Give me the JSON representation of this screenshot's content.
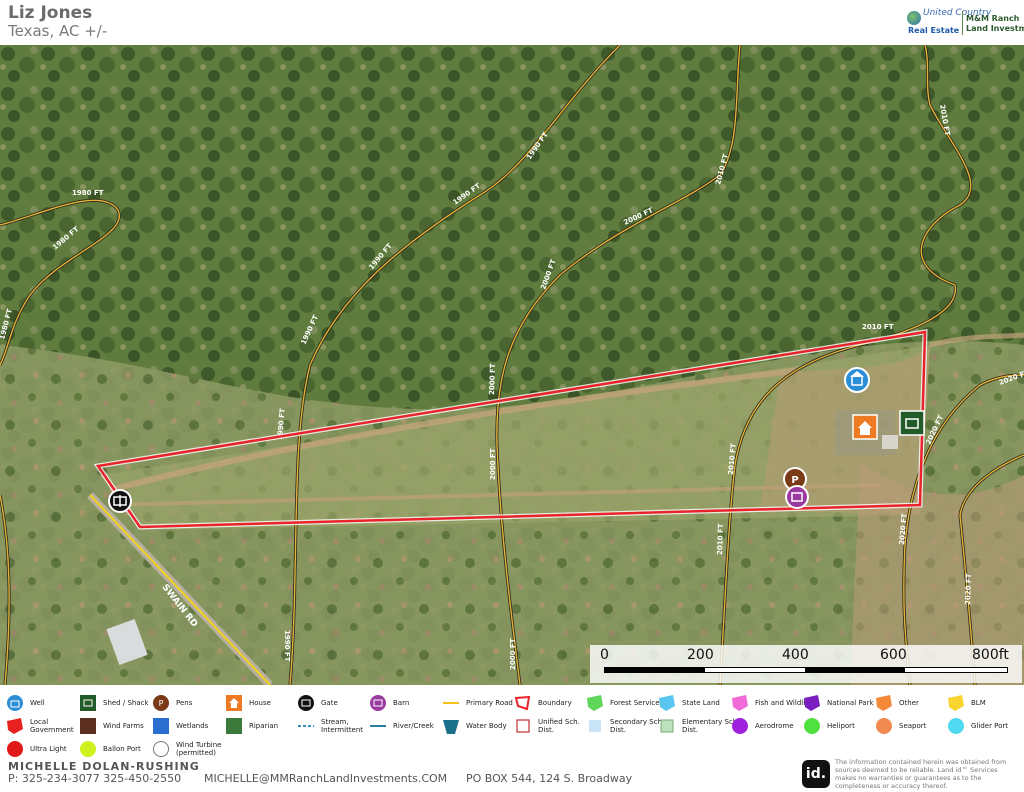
{
  "header": {
    "owner": "Liz Jones",
    "location": "Texas,  AC +/-",
    "logo_line1": "United Country",
    "logo_line2": "Real Estate",
    "logo_brand1": "M&M Ranch",
    "logo_brand2": "Land Investments"
  },
  "map": {
    "contours": [
      "1980 FT",
      "1980 FT",
      "1980 FT",
      "1990 FT",
      "1990 FT",
      "1990 FT",
      "1990 FT",
      "1990 FT",
      "1990 FT",
      "2000 FT",
      "2000 FT",
      "2000 FT",
      "2000 FT",
      "2000 FT",
      "2010 FT",
      "2010 FT",
      "2010 FT",
      "2010 FT",
      "2010 FT",
      "2020 FT",
      "2020 FT",
      "2020 FT",
      "2020 FT"
    ],
    "road_label": "SWAIN RD",
    "colors": {
      "boundary": "#e8232a",
      "contour": "#e0b43a",
      "road": "#f2d21a"
    },
    "markers": [
      {
        "name": "well",
        "icon": "well-icon"
      },
      {
        "name": "house",
        "icon": "house-icon"
      },
      {
        "name": "shed",
        "icon": "shed-icon"
      },
      {
        "name": "pens",
        "icon": "pens-icon"
      },
      {
        "name": "barn",
        "icon": "barn-icon"
      },
      {
        "name": "gate",
        "icon": "gate-icon"
      }
    ]
  },
  "scalebar": {
    "labels": [
      "0",
      "200",
      "400",
      "600",
      "800ft"
    ]
  },
  "legend": [
    {
      "label": "Well",
      "icon": "well-icon"
    },
    {
      "label": "Shed / Shack",
      "icon": "shed-icon"
    },
    {
      "label": "Pens",
      "icon": "pens-icon"
    },
    {
      "label": "House",
      "icon": "house-icon"
    },
    {
      "label": "Gate",
      "icon": "gate-icon"
    },
    {
      "label": "Barn",
      "icon": "barn-icon"
    },
    {
      "label": "Primary Road",
      "icon": "primary-road-icon"
    },
    {
      "label": "Boundary",
      "icon": "boundary-icon"
    },
    {
      "label": "Forest Service",
      "icon": "forest-service-icon"
    },
    {
      "label": "State Land",
      "icon": "state-land-icon"
    },
    {
      "label": "Fish and Wildlife",
      "icon": "fish-wildlife-icon"
    },
    {
      "label": "National Park",
      "icon": "national-park-icon"
    },
    {
      "label": "Other",
      "icon": "other-icon"
    },
    {
      "label": "BLM",
      "icon": "blm-icon"
    },
    {
      "label": "Local Government",
      "icon": "local-government-icon"
    },
    {
      "label": "Wind Farms",
      "icon": "wind-farms-icon"
    },
    {
      "label": "Wetlands",
      "icon": "wetlands-icon"
    },
    {
      "label": "Riparian",
      "icon": "riparian-icon"
    },
    {
      "label": "Stream, Intermittent",
      "icon": "stream-intermittent-icon"
    },
    {
      "label": "River/Creek",
      "icon": "river-creek-icon"
    },
    {
      "label": "Water Body",
      "icon": "water-body-icon"
    },
    {
      "label": "Unified Sch. Dist.",
      "icon": "unified-school-icon"
    },
    {
      "label": "Secondary Sch. Dist.",
      "icon": "secondary-school-icon"
    },
    {
      "label": "Elementary Sch. Dist.",
      "icon": "elementary-school-icon"
    },
    {
      "label": "Aerodrome",
      "icon": "aerodrome-icon"
    },
    {
      "label": "Heliport",
      "icon": "heliport-icon"
    },
    {
      "label": "Seaport",
      "icon": "seaport-icon"
    },
    {
      "label": "Glider Port",
      "icon": "glider-port-icon"
    },
    {
      "label": "Ultra Light",
      "icon": "ultra-light-icon"
    },
    {
      "label": "Ballon Port",
      "icon": "ballon-port-icon"
    },
    {
      "label": "Wind Turbine (permitted)",
      "icon": "wind-turbine-icon"
    }
  ],
  "footer": {
    "agent": "MICHELLE  DOLAN-RUSHING",
    "phone": "P: 325-234-3077 325-450-2550",
    "email": "MICHELLE@MMRanchLandInvestments.COM",
    "address": "PO BOX 544, 124 S. Broadway",
    "id_logo": "id.",
    "disclaimer": "The information contained herein was obtained from sources deemed to be reliable. Land id™ Services makes no warranties or guarantees as to the completeness or accuracy thereof."
  }
}
